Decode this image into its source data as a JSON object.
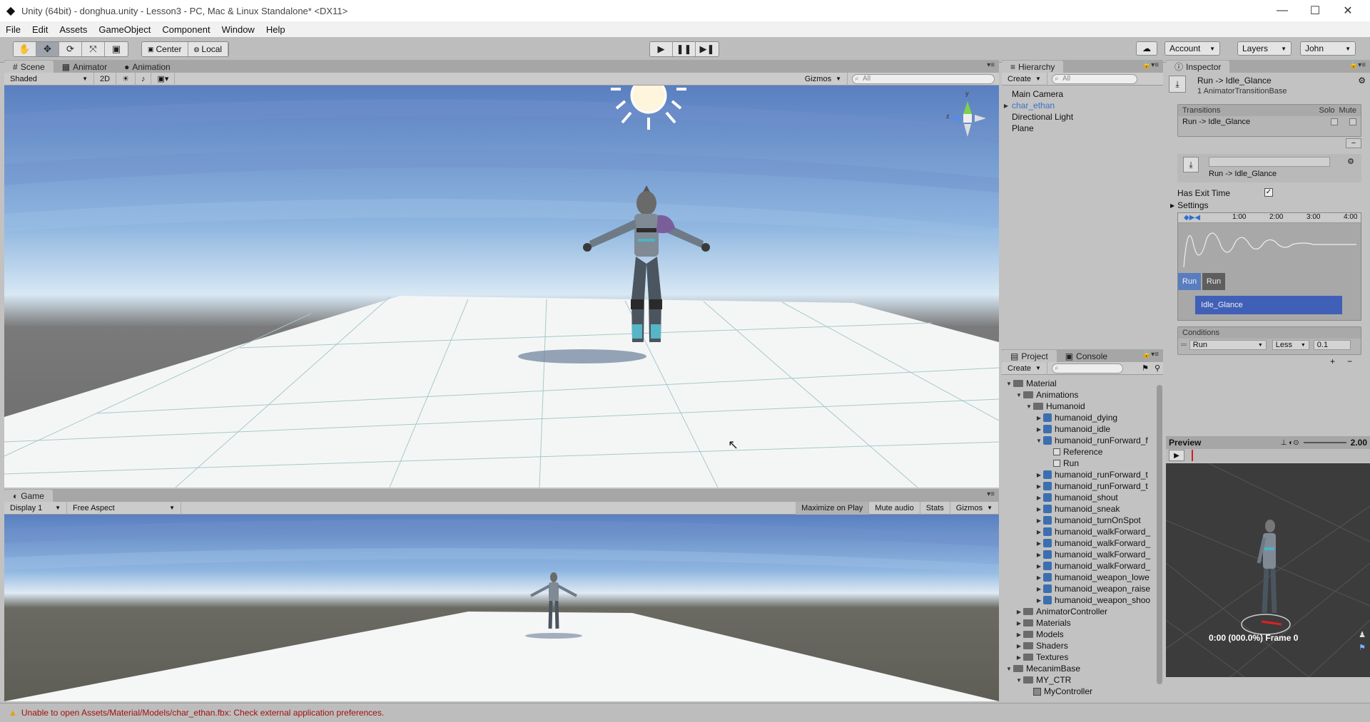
{
  "window": {
    "title": "Unity (64bit) - donghua.unity - Lesson3 - PC, Mac & Linux Standalone* <DX11>",
    "minimize": "—",
    "maximize": "☐",
    "close": "✕"
  },
  "menu": [
    "File",
    "Edit",
    "Assets",
    "GameObject",
    "Component",
    "Window",
    "Help"
  ],
  "toolbar": {
    "pivot": "Center",
    "space": "Local",
    "account": "Account",
    "layers": "Layers",
    "layout": "John"
  },
  "scene": {
    "tabs": [
      "Scene",
      "Animator",
      "Animation"
    ],
    "shading": "Shaded",
    "mode_2d": "2D",
    "gizmos": "Gizmos",
    "search_placeholder": "All",
    "gizmo_y": "y",
    "gizmo_z": "z"
  },
  "game": {
    "tab": "Game",
    "display": "Display 1",
    "aspect": "Free Aspect",
    "maximize_on_play": "Maximize on Play",
    "mute_audio": "Mute audio",
    "stats": "Stats",
    "gizmos": "Gizmos"
  },
  "hierarchy": {
    "tab": "Hierarchy",
    "create": "Create",
    "search_placeholder": "All",
    "items": [
      {
        "label": "Main Camera",
        "selected": false,
        "expandable": false
      },
      {
        "label": "char_ethan",
        "selected": true,
        "expandable": true
      },
      {
        "label": "Directional Light",
        "selected": false,
        "expandable": false
      },
      {
        "label": "Plane",
        "selected": false,
        "expandable": false
      }
    ]
  },
  "project": {
    "tabs": [
      "Project",
      "Console"
    ],
    "create": "Create",
    "tree": [
      {
        "label": "Material",
        "depth": 0,
        "type": "folder",
        "arrow": "down"
      },
      {
        "label": "Animations",
        "depth": 1,
        "type": "folder",
        "arrow": "down"
      },
      {
        "label": "Humanoid",
        "depth": 2,
        "type": "folder",
        "arrow": "down"
      },
      {
        "label": "humanoid_dying",
        "depth": 3,
        "type": "anim",
        "arrow": "right"
      },
      {
        "label": "humanoid_idle",
        "depth": 3,
        "type": "anim",
        "arrow": "right"
      },
      {
        "label": "humanoid_runForward_f",
        "depth": 3,
        "type": "anim",
        "arrow": "down"
      },
      {
        "label": "Reference",
        "depth": 4,
        "type": "clip",
        "arrow": ""
      },
      {
        "label": "Run",
        "depth": 4,
        "type": "clip",
        "arrow": ""
      },
      {
        "label": "humanoid_runForward_t",
        "depth": 3,
        "type": "anim",
        "arrow": "right"
      },
      {
        "label": "humanoid_runForward_t",
        "depth": 3,
        "type": "anim",
        "arrow": "right"
      },
      {
        "label": "humanoid_shout",
        "depth": 3,
        "type": "anim",
        "arrow": "right"
      },
      {
        "label": "humanoid_sneak",
        "depth": 3,
        "type": "anim",
        "arrow": "right"
      },
      {
        "label": "humanoid_turnOnSpot",
        "depth": 3,
        "type": "anim",
        "arrow": "right"
      },
      {
        "label": "humanoid_walkForward_",
        "depth": 3,
        "type": "anim",
        "arrow": "right"
      },
      {
        "label": "humanoid_walkForward_",
        "depth": 3,
        "type": "anim",
        "arrow": "right"
      },
      {
        "label": "humanoid_walkForward_",
        "depth": 3,
        "type": "anim",
        "arrow": "right"
      },
      {
        "label": "humanoid_walkForward_",
        "depth": 3,
        "type": "anim",
        "arrow": "right"
      },
      {
        "label": "humanoid_weapon_lowe",
        "depth": 3,
        "type": "anim",
        "arrow": "right"
      },
      {
        "label": "humanoid_weapon_raise",
        "depth": 3,
        "type": "anim",
        "arrow": "right"
      },
      {
        "label": "humanoid_weapon_shoo",
        "depth": 3,
        "type": "anim",
        "arrow": "right"
      },
      {
        "label": "AnimatorController",
        "depth": 1,
        "type": "folder",
        "arrow": "right"
      },
      {
        "label": "Materials",
        "depth": 1,
        "type": "folder",
        "arrow": "right"
      },
      {
        "label": "Models",
        "depth": 1,
        "type": "folder",
        "arrow": "right"
      },
      {
        "label": "Shaders",
        "depth": 1,
        "type": "folder",
        "arrow": "right"
      },
      {
        "label": "Textures",
        "depth": 1,
        "type": "folder",
        "arrow": "right"
      },
      {
        "label": "MecanimBase",
        "depth": 0,
        "type": "folder",
        "arrow": "down"
      },
      {
        "label": "MY_CTR",
        "depth": 1,
        "type": "folder",
        "arrow": "down"
      },
      {
        "label": "MyController",
        "depth": 2,
        "type": "ctrl",
        "arrow": ""
      }
    ]
  },
  "inspector": {
    "tab": "Inspector",
    "object_title": "Run -> Idle_Glance",
    "object_subtitle": "1 AnimatorTransitionBase",
    "transitions_header": "Transitions",
    "solo": "Solo",
    "mute": "Mute",
    "transition_row": "Run -> Idle_Glance",
    "minus": "−",
    "transition_name": "Run -> Idle_Glance",
    "has_exit_time_label": "Has Exit Time",
    "has_exit_time": true,
    "settings_label": "Settings",
    "timeline_ticks": [
      "1:00",
      "2:00",
      "3:00",
      "4:00"
    ],
    "timeline_state1": "Run",
    "timeline_state2": "Run",
    "timeline_state3": "Idle_Glance",
    "conditions_header": "Conditions",
    "condition_param": "Run",
    "condition_op": "Less",
    "condition_value": "0.1",
    "plus": "+",
    "preview_label": "Preview",
    "preview_speed": "2.00",
    "preview_time": "0:00 (000.0%) Frame 0"
  },
  "status": {
    "message": "Unable to open Assets/Material/Models/char_ethan.fbx: Check external application preferences."
  },
  "colors": {
    "selection": "#3a72c4",
    "warning": "#e0a000",
    "error_text": "#a01010"
  }
}
